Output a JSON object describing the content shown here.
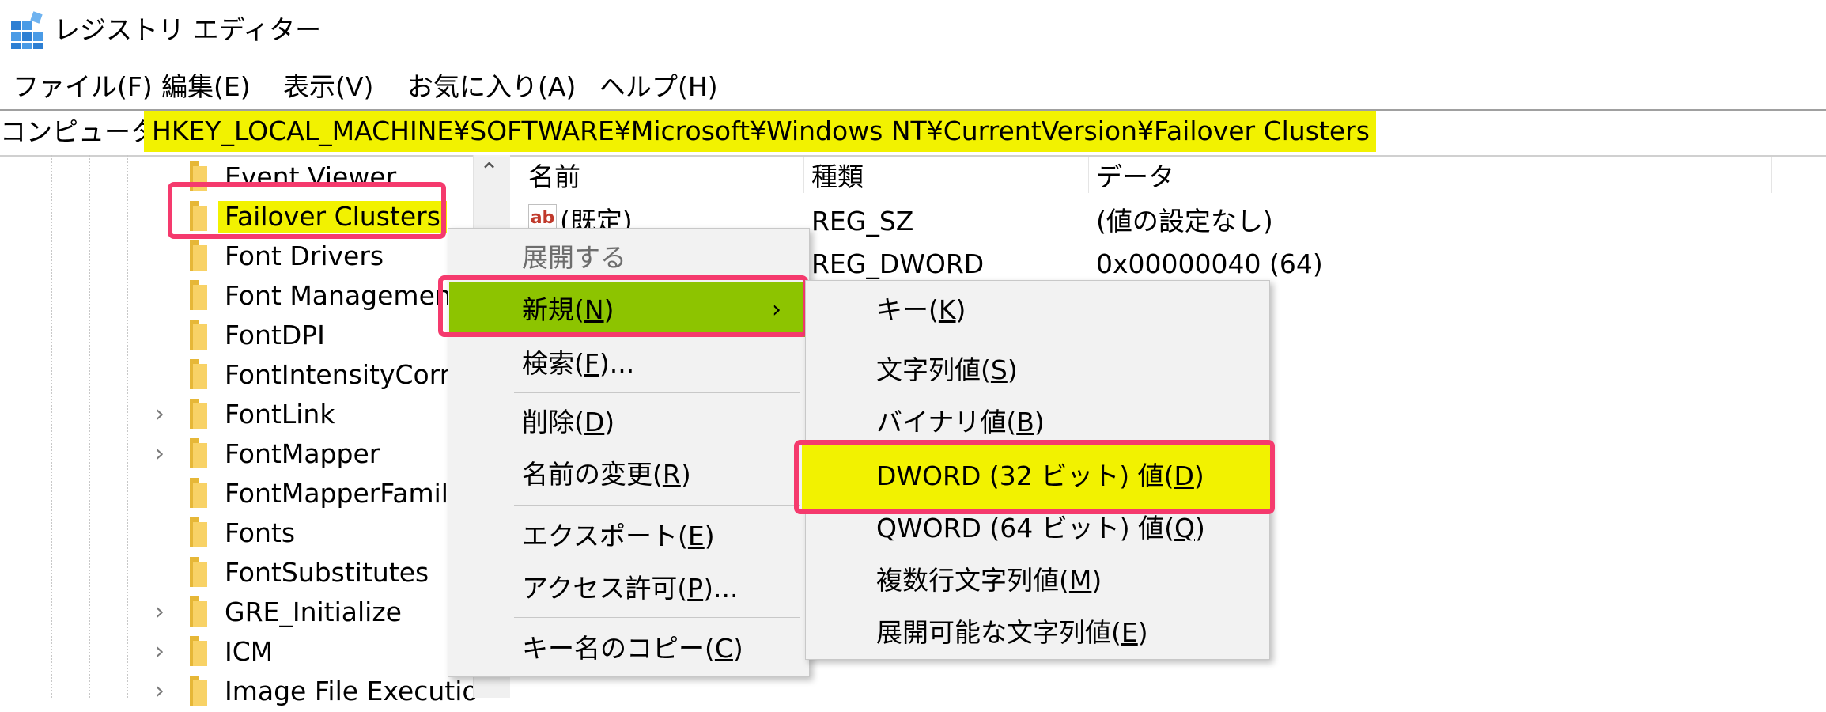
{
  "window": {
    "title": "レジストリ エディター",
    "icon": "registry-editor-icon"
  },
  "menu": [
    "ファイル(F)",
    "編集(E)",
    "表示(V)",
    "お気に入り(A)",
    "ヘルプ(H)"
  ],
  "address": {
    "prefix": "コンピューター¥",
    "path": "HKEY_LOCAL_MACHINE¥SOFTWARE¥Microsoft¥Windows NT¥CurrentVersion¥Failover Clusters",
    "highlight_color": "#f2f200"
  },
  "tree": {
    "items": [
      {
        "label": "Event Viewer",
        "expandable": false
      },
      {
        "label": "Failover Clusters",
        "expandable": false,
        "selected": true
      },
      {
        "label": "Font Drivers",
        "expandable": false
      },
      {
        "label": "Font Managemen",
        "expandable": false
      },
      {
        "label": "FontDPI",
        "expandable": false
      },
      {
        "label": "FontIntensityCorre",
        "expandable": false
      },
      {
        "label": "FontLink",
        "expandable": true
      },
      {
        "label": "FontMapper",
        "expandable": true
      },
      {
        "label": "FontMapperFamily",
        "expandable": false
      },
      {
        "label": "Fonts",
        "expandable": false
      },
      {
        "label": "FontSubstitutes",
        "expandable": false
      },
      {
        "label": "GRE_Initialize",
        "expandable": true
      },
      {
        "label": "ICM",
        "expandable": true
      },
      {
        "label": "Image File Executio",
        "expandable": true
      }
    ]
  },
  "list": {
    "columns": [
      "名前",
      "種類",
      "データ"
    ],
    "rows": [
      {
        "name": "(既定)",
        "type": "REG_SZ",
        "data": "(値の設定なし)"
      },
      {
        "name": "",
        "type": "REG_DWORD",
        "data": "0x00000040 (64)"
      }
    ]
  },
  "context_menu": {
    "expand": "展開する",
    "new": {
      "text": "新規(",
      "key": "N",
      "end": ")"
    },
    "find": {
      "text": "検索(",
      "key": "F",
      "end": ")..."
    },
    "delete": {
      "text": "削除(",
      "key": "D",
      "end": ")"
    },
    "rename": {
      "text": "名前の変更(",
      "key": "R",
      "end": ")"
    },
    "export": {
      "text": "エクスポート(",
      "key": "E",
      "end": ")"
    },
    "permissions": {
      "text": "アクセス許可(",
      "key": "P",
      "end": ")..."
    },
    "copy_key_name": {
      "text": "キー名のコピー(",
      "key": "C",
      "end": ")"
    },
    "new_highlight_color": "#8dc400"
  },
  "submenu": {
    "key": {
      "text": "キー(",
      "key": "K",
      "end": ")"
    },
    "string": {
      "text": "文字列値(",
      "key": "S",
      "end": ")"
    },
    "binary": {
      "text": "バイナリ値(",
      "key": "B",
      "end": ")"
    },
    "dword": {
      "text": "DWORD (32 ビット) 値(",
      "key": "D",
      "end": ")"
    },
    "qword": {
      "text": "QWORD (64 ビット) 値(",
      "key": "Q",
      "end": ")"
    },
    "multi_string": {
      "text": "複数行文字列値(",
      "key": "M",
      "end": ")"
    },
    "expandable_string": {
      "text": "展開可能な文字列値(",
      "key": "E",
      "end": ")"
    },
    "dword_highlight_color": "#f2f200"
  },
  "annotation_frame_color": "#f53a6d"
}
